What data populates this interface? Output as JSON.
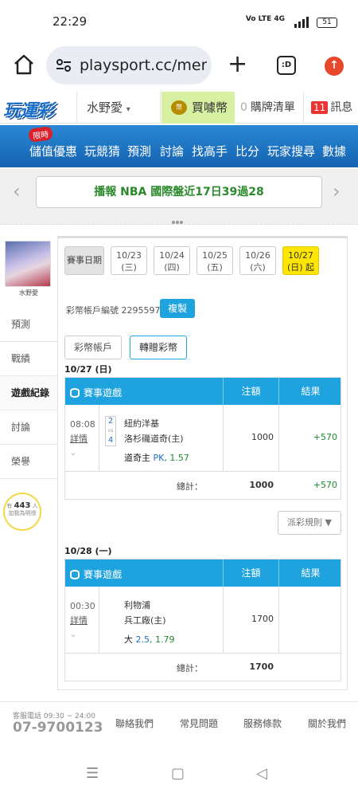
{
  "status": {
    "time": "22:29",
    "signal": "Vo LTE 4G",
    "battery": "51"
  },
  "browser": {
    "url": "playsport.cc/men",
    "tabs_label": ":D"
  },
  "site": {
    "logo": "玩運彩",
    "user": "水野愛",
    "buy_coin": "買噱幣",
    "orders_count": "0",
    "orders_label": "購牌清單",
    "msg_count": "11",
    "msg_label": "訊息"
  },
  "nav": {
    "hot": "限時",
    "items": [
      "儲值優惠",
      "玩競猜",
      "預測",
      "討論",
      "找高手",
      "比分",
      "玩家搜尋",
      "數據"
    ]
  },
  "news": {
    "prefix": "播報",
    "text": "NBA 國際盤近17日39過28"
  },
  "sidebar": {
    "username": "水野愛",
    "items": [
      "預測",
      "戰績",
      "遊戲紀錄",
      "討論",
      "榮譽"
    ],
    "fans_pre": "有",
    "fans_count": "443",
    "fans_post": "人",
    "fans_note": "加我為明燈"
  },
  "filter": {
    "label": "賽事日期",
    "dates": [
      {
        "d": "10/23",
        "w": "(三)"
      },
      {
        "d": "10/24",
        "w": "(四)"
      },
      {
        "d": "10/25",
        "w": "(五)"
      },
      {
        "d": "10/26",
        "w": "(六)"
      },
      {
        "d": "10/27",
        "w": "(日) 起"
      }
    ]
  },
  "account": {
    "label": "彩幣帳戶編號 22955975",
    "copy": "複製"
  },
  "tabs": [
    "彩幣帳戶",
    "轉贈彩幣"
  ],
  "table_head": {
    "game": "賽事遊戲",
    "stake": "注額",
    "result": "結果"
  },
  "days": [
    {
      "title": "10/27 (日)",
      "row": {
        "time": "08:08",
        "detail": "詳情",
        "score_top": "2",
        "score_mid": "vs",
        "score_bot": "4",
        "team1": "紐約洋基",
        "team2": "洛杉磯道奇(主)",
        "pick_name": "道奇主",
        "pick_type": "PK",
        "pick_odds": "1.57",
        "stake": "1000",
        "result": "+570"
      },
      "total_label": "總計：",
      "total_stake": "1000",
      "total_result": "+570"
    },
    {
      "title": "10/28 (一)",
      "row": {
        "time": "00:30",
        "detail": "詳情",
        "team1": "利物浦",
        "team2": "兵工廠(主)",
        "pick_name": "大",
        "pick_type": "2.5",
        "pick_odds": "1.79",
        "stake": "1700",
        "result": ""
      },
      "total_label": "總計：",
      "total_stake": "1700",
      "total_result": ""
    }
  ],
  "rules": "派彩規則 ▼",
  "footer": {
    "tel_label": "客服電話 09:30 ~ 24:00",
    "tel": "07-9700123",
    "links": [
      "聯絡我們",
      "常見問題",
      "服務條款",
      "關於我們"
    ]
  }
}
